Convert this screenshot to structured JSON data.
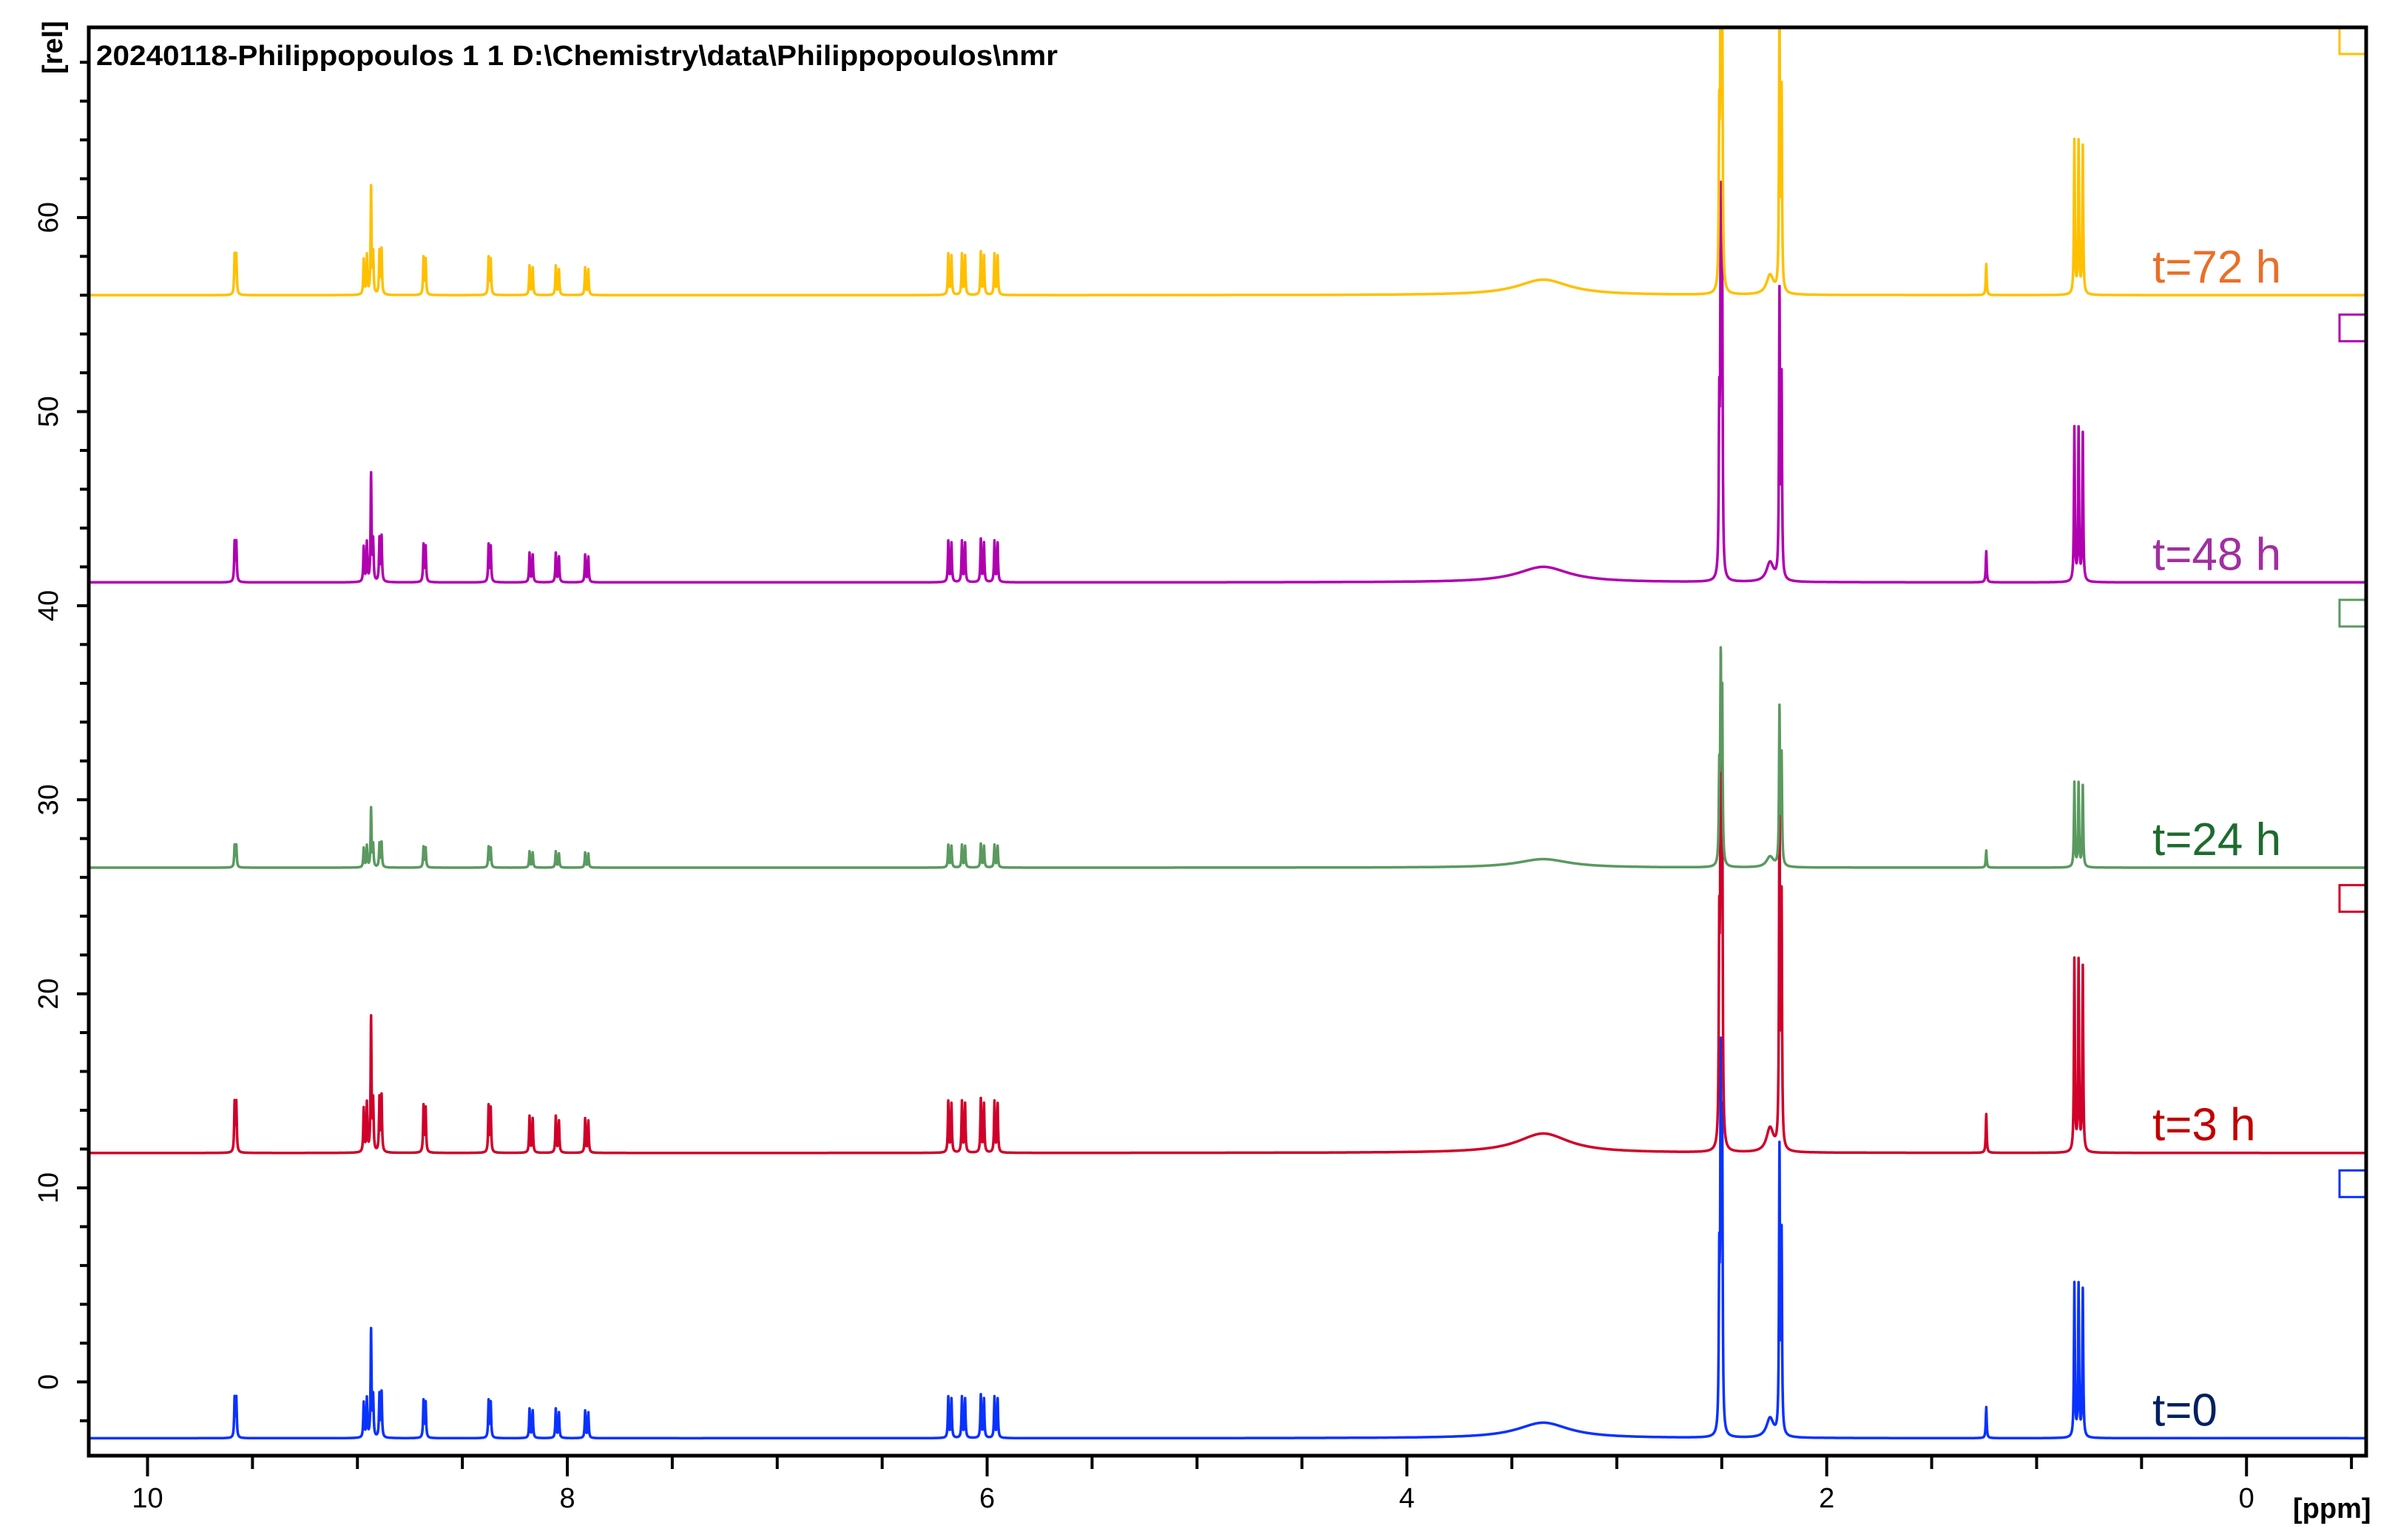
{
  "chart_data": {
    "type": "line",
    "title": "20240118-Philippopoulos  1  1  D:\\Chemistry\\data\\Philippopoulos\\nmr",
    "xlabel": "[ppm]",
    "ylabel": "[rel]",
    "xlim": [
      10.28,
      -0.57
    ],
    "ylim": [
      -3.8,
      69.8
    ],
    "x_ticks": [
      10,
      8,
      6,
      4,
      2,
      0
    ],
    "x_tick_labels": [
      "10",
      "8",
      "6",
      "4",
      "2",
      "0"
    ],
    "y_ticks": [
      0,
      10,
      20,
      30,
      40,
      50,
      60
    ],
    "y_tick_labels": [
      "0",
      "10",
      "20",
      "30",
      "40",
      "50",
      "60"
    ],
    "grid": false,
    "peaks": [
      {
        "ppm": 9.585,
        "h": 2.0
      },
      {
        "ppm": 9.577,
        "h": 2.0
      },
      {
        "ppm": 8.97,
        "h": 1.8
      },
      {
        "ppm": 8.955,
        "h": 2.0
      },
      {
        "ppm": 8.935,
        "h": 5.5
      },
      {
        "ppm": 8.925,
        "h": 2.0
      },
      {
        "ppm": 8.895,
        "h": 2.2
      },
      {
        "ppm": 8.885,
        "h": 2.3
      },
      {
        "ppm": 8.685,
        "h": 1.9
      },
      {
        "ppm": 8.675,
        "h": 1.8
      },
      {
        "ppm": 8.375,
        "h": 1.9
      },
      {
        "ppm": 8.365,
        "h": 1.8
      },
      {
        "ppm": 8.18,
        "h": 1.5
      },
      {
        "ppm": 8.165,
        "h": 1.4
      },
      {
        "ppm": 8.055,
        "h": 1.5
      },
      {
        "ppm": 8.04,
        "h": 1.3
      },
      {
        "ppm": 7.915,
        "h": 1.4
      },
      {
        "ppm": 7.9,
        "h": 1.3
      },
      {
        "ppm": 6.185,
        "h": 2.1
      },
      {
        "ppm": 6.17,
        "h": 2.0
      },
      {
        "ppm": 6.12,
        "h": 2.1
      },
      {
        "ppm": 6.105,
        "h": 2.0
      },
      {
        "ppm": 6.03,
        "h": 2.2
      },
      {
        "ppm": 6.015,
        "h": 2.0
      },
      {
        "ppm": 5.965,
        "h": 2.1
      },
      {
        "ppm": 5.95,
        "h": 2.0
      },
      {
        "ppm": 3.35,
        "h": 0.8,
        "w": 0.15
      },
      {
        "ppm": 2.512,
        "h": 8.0
      },
      {
        "ppm": 2.505,
        "h": 18.0
      },
      {
        "ppm": 2.498,
        "h": 15.0
      },
      {
        "ppm": 2.27,
        "h": 1.0,
        "w": 0.02
      },
      {
        "ppm": 2.225,
        "h": 14.5
      },
      {
        "ppm": 2.215,
        "h": 10.0
      },
      {
        "ppm": 1.24,
        "h": 1.6
      },
      {
        "ppm": 0.82,
        "h": 7.9
      },
      {
        "ppm": 0.8,
        "h": 7.8
      },
      {
        "ppm": 0.78,
        "h": 7.6
      }
    ],
    "series": [
      {
        "name": "t=0",
        "baseline": -2.9,
        "scale": 1.0,
        "color": "#0a32ff",
        "label_color": "#002060"
      },
      {
        "name": "t=3 h",
        "baseline": 11.8,
        "scale": 1.25,
        "color": "#d0002a",
        "label_color": "#c00000"
      },
      {
        "name": "t=24 h",
        "baseline": 26.5,
        "scale": 0.55,
        "color": "#5a9a5f",
        "label_color": "#1e6b2e"
      },
      {
        "name": "t=48 h",
        "baseline": 41.2,
        "scale": 1.0,
        "color": "#b000b0",
        "label_color": "#a0309f"
      },
      {
        "name": "t=72 h",
        "baseline": 56.0,
        "scale": 1.0,
        "color": "#ffc000",
        "label_color": "#e8702a"
      }
    ]
  }
}
